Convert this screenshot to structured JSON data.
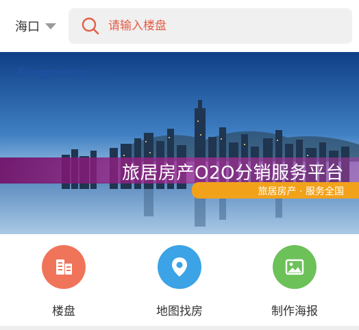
{
  "header": {
    "city": "海口",
    "search_placeholder": "请输入楼盘"
  },
  "banner": {
    "logo_main": "Fangmeng",
    "logo_suffix": ".com",
    "slogan": "旅居房产O2O分销服务平台",
    "subtitle": "旅居房产 · 服务全国"
  },
  "nav": {
    "items": [
      {
        "label": "楼盘",
        "icon": "building-icon",
        "color": "#f0745a"
      },
      {
        "label": "地图找房",
        "icon": "map-pin-icon",
        "color": "#3ba3e6"
      },
      {
        "label": "制作海报",
        "icon": "image-icon",
        "color": "#6cc158"
      }
    ]
  }
}
